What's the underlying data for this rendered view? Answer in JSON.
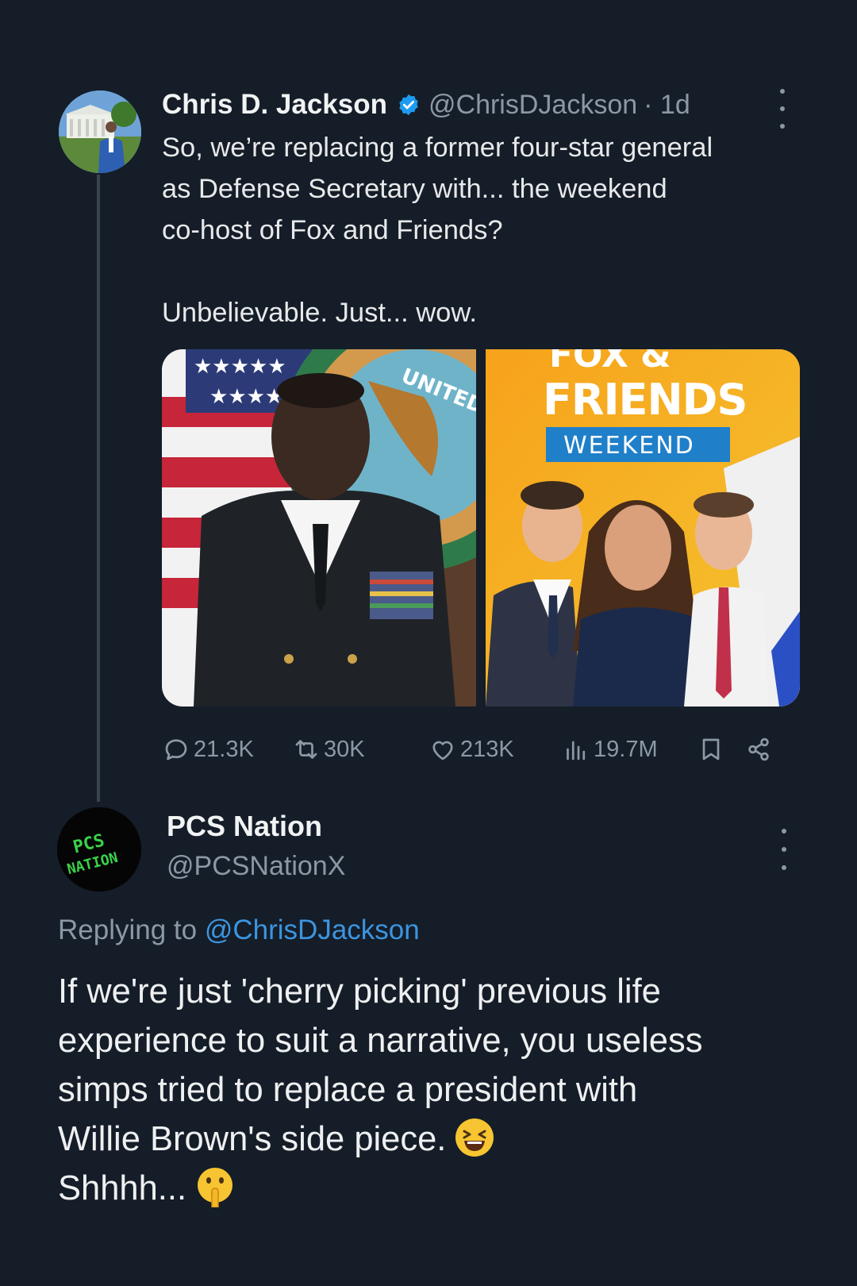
{
  "tweet1": {
    "author_name": "Chris D. Jackson",
    "handle": "@ChrisDJackson",
    "time": "· 1d",
    "text_lines": [
      "So, we’re replacing a former four-star general",
      "as Defense Secretary with... the weekend",
      "co-host of Fox and Friends?",
      "Unbelievable. Just... wow."
    ],
    "image_left": {
      "emblem_text": "UNITED"
    },
    "image_right": {
      "logo_line1": "FOX &",
      "logo_line2": "FRIENDS",
      "logo_line3": "WEEKEND"
    },
    "stats": {
      "replies": "21.3K",
      "reposts": "30K",
      "likes": "213K",
      "views": "19.7M"
    },
    "colors": {
      "verified": "#1d9bf0",
      "muted": "#8b98a5"
    }
  },
  "tweet2": {
    "author_name": "PCS Nation",
    "handle": "@PCSNationX",
    "avatar_text_1": "PCS",
    "avatar_text_2": "NATION",
    "replying_prefix": "Replying to",
    "replying_handle": "@ChrisDJackson",
    "text_lines": [
      "If we're just 'cherry picking' previous life",
      "experience to suit a narrative, you useless",
      "simps tried to replace a president with",
      "Willie Brown's side piece.",
      "Shhhh..."
    ],
    "emojis": [
      "laughing-face",
      "shushing-face"
    ],
    "colors": {
      "link": "#3b95e0"
    }
  }
}
